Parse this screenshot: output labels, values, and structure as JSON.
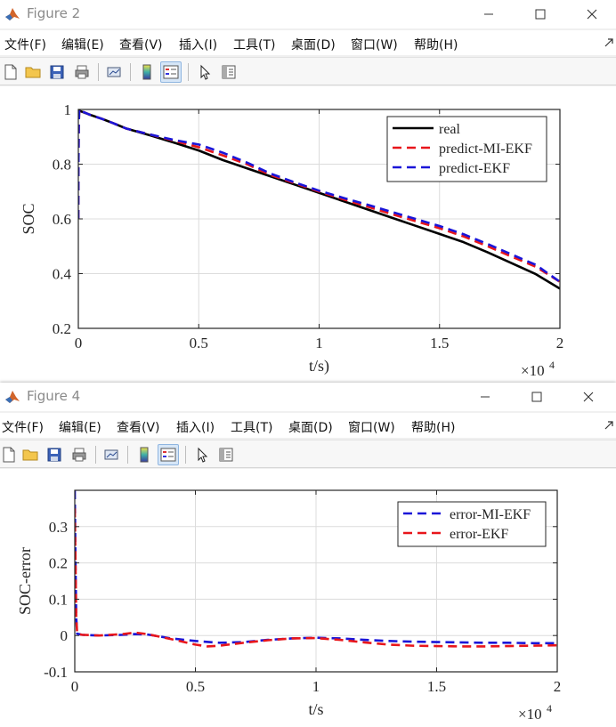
{
  "colors": {
    "real": "#000000",
    "mi_ekf_red": "#e8161b",
    "ekf_blue": "#1a15d8",
    "grid": "#dcdcdc",
    "title_text": "#8a8a8a"
  },
  "windows": [
    {
      "title": "Figure 2",
      "menu": [
        "文件(F)",
        "编辑(E)",
        "查看(V)",
        "插入(I)",
        "工具(T)",
        "桌面(D)",
        "窗口(W)",
        "帮助(H)"
      ],
      "toolbar_icons": [
        "new-figure-icon",
        "open-folder-icon",
        "save-icon",
        "print-icon",
        "link-plot-icon",
        "colorbar-icon",
        "legend-icon",
        "pointer-icon",
        "property-editor-icon"
      ]
    },
    {
      "title": "Figure 4",
      "menu": [
        "文件(F)",
        "编辑(E)",
        "查看(V)",
        "插入(I)",
        "工具(T)",
        "桌面(D)",
        "窗口(W)",
        "帮助(H)"
      ],
      "toolbar_icons": [
        "new-figure-icon",
        "open-folder-icon",
        "save-icon",
        "print-icon",
        "link-plot-icon",
        "colorbar-icon",
        "legend-icon",
        "pointer-icon",
        "property-editor-icon"
      ]
    }
  ],
  "chart_data": [
    {
      "type": "line",
      "title": "",
      "xlabel": "t/s)",
      "ylabel": "SOC",
      "xlim": [
        0,
        20000
      ],
      "ylim": [
        0.2,
        1
      ],
      "x_exponent_label": "×10",
      "x_exponent_power": "4",
      "xticks": [
        0,
        5000,
        10000,
        15000,
        20000
      ],
      "xtick_labels": [
        "0",
        "0.5",
        "1",
        "1.5",
        "2"
      ],
      "yticks": [
        0.2,
        0.4,
        0.6,
        0.8,
        1
      ],
      "ytick_labels": [
        "0.2",
        "0.4",
        "0.6",
        "0.8",
        "1"
      ],
      "grid": true,
      "legend_position": "top-right",
      "series": [
        {
          "name": "real",
          "style": "solid",
          "color": "#000000",
          "x": [
            0,
            50,
            500,
            1000,
            1500,
            2000,
            3000,
            4000,
            5000,
            6000,
            7000,
            8000,
            9000,
            10000,
            11000,
            12000,
            13000,
            14000,
            15000,
            16000,
            17000,
            18000,
            19000,
            20000
          ],
          "y": [
            1,
            0.995,
            0.98,
            0.965,
            0.948,
            0.93,
            0.905,
            0.878,
            0.85,
            0.815,
            0.785,
            0.755,
            0.725,
            0.695,
            0.665,
            0.635,
            0.605,
            0.575,
            0.545,
            0.515,
            0.478,
            0.438,
            0.398,
            0.345
          ]
        },
        {
          "name": "predict-MI-EKF",
          "style": "dashed",
          "color": "#e8161b",
          "x": [
            0,
            5,
            20,
            40,
            60,
            100,
            500,
            1000,
            1500,
            2000,
            3000,
            4000,
            5000,
            6000,
            7000,
            8000,
            9000,
            10000,
            11000,
            12000,
            13000,
            14000,
            15000,
            16000,
            17000,
            18000,
            19000,
            20000
          ],
          "y": [
            0.6,
            0.8,
            0.95,
            1,
            1,
            0.995,
            0.98,
            0.965,
            0.948,
            0.93,
            0.908,
            0.885,
            0.862,
            0.832,
            0.8,
            0.76,
            0.73,
            0.7,
            0.672,
            0.645,
            0.618,
            0.592,
            0.566,
            0.536,
            0.5,
            0.462,
            0.425,
            0.37
          ]
        },
        {
          "name": "predict-EKF",
          "style": "dashed",
          "color": "#1a15d8",
          "x": [
            0,
            5,
            20,
            40,
            60,
            100,
            500,
            1000,
            1500,
            2000,
            3000,
            4000,
            5000,
            6000,
            7000,
            8000,
            9000,
            10000,
            11000,
            12000,
            13000,
            14000,
            15000,
            16000,
            17000,
            18000,
            19000,
            20000
          ],
          "y": [
            0.6,
            0.8,
            0.95,
            1,
            1,
            0.995,
            0.98,
            0.965,
            0.948,
            0.93,
            0.908,
            0.888,
            0.872,
            0.842,
            0.806,
            0.765,
            0.733,
            0.703,
            0.677,
            0.652,
            0.626,
            0.6,
            0.574,
            0.544,
            0.508,
            0.47,
            0.432,
            0.37
          ]
        }
      ]
    },
    {
      "type": "line",
      "title": "",
      "xlabel": "t/s",
      "ylabel": "SOC-error",
      "xlim": [
        0,
        20000
      ],
      "ylim": [
        -0.1,
        0.4
      ],
      "x_exponent_label": "×10",
      "x_exponent_power": "4",
      "xticks": [
        0,
        5000,
        10000,
        15000,
        20000
      ],
      "xtick_labels": [
        "0",
        "0.5",
        "1",
        "1.5",
        "2"
      ],
      "yticks": [
        -0.1,
        0,
        0.1,
        0.2,
        0.3
      ],
      "ytick_labels": [
        "-0.1",
        "0",
        "0.1",
        "0.2",
        "0.3"
      ],
      "grid": true,
      "legend_position": "top-right",
      "series": [
        {
          "name": "error-MI-EKF",
          "style": "dashed",
          "color": "#1a15d8",
          "x": [
            0,
            30,
            60,
            100,
            300,
            1000,
            2000,
            2500,
            3000,
            4000,
            5000,
            6000,
            7000,
            8000,
            9000,
            10000,
            11000,
            12000,
            13000,
            14000,
            15000,
            16000,
            17000,
            18000,
            19000,
            20000
          ],
          "y": [
            0.4,
            0.2,
            0.05,
            0.005,
            0.002,
            0,
            0.002,
            0.004,
            0.003,
            -0.008,
            -0.015,
            -0.02,
            -0.018,
            -0.012,
            -0.008,
            -0.006,
            -0.008,
            -0.012,
            -0.015,
            -0.017,
            -0.018,
            -0.019,
            -0.02,
            -0.02,
            -0.021,
            -0.021
          ]
        },
        {
          "name": "error-EKF",
          "style": "dashed",
          "color": "#e8161b",
          "x": [
            0,
            30,
            60,
            100,
            300,
            1000,
            2000,
            2500,
            3000,
            4000,
            5000,
            5500,
            6000,
            7000,
            8000,
            9000,
            10000,
            11000,
            12000,
            13000,
            14000,
            15000,
            16000,
            17000,
            18000,
            19000,
            20000
          ],
          "y": [
            0.35,
            0.2,
            0.05,
            0.005,
            0.002,
            0,
            0.004,
            0.008,
            0.004,
            -0.01,
            -0.025,
            -0.03,
            -0.028,
            -0.02,
            -0.013,
            -0.008,
            -0.007,
            -0.012,
            -0.019,
            -0.025,
            -0.028,
            -0.029,
            -0.03,
            -0.03,
            -0.029,
            -0.028,
            -0.027
          ]
        }
      ]
    }
  ]
}
